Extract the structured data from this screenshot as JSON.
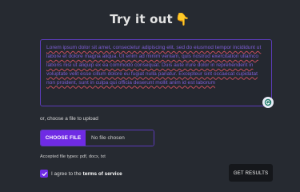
{
  "header": {
    "title": "Try it out",
    "emoji": "👇"
  },
  "text_input": {
    "value": "Lorem ipsum dolor sit amet, consectetur adipiscing elit, sed do eiusmod tempor incididunt ut labore et dolore magna aliqua. Ut enim ad minim veniam, quis nostrud exercitation ullamco laboris nisi ut aliquip ex ea commodo consequat. Duis aute irure dolor in reprehenderit in voluptate velit esse cillum dolore eu fugiat nulla pariatur. Excepteur sint occaecat cupidatat non proident, sunt in culpa qui officia deserunt mollit anim id est laborum",
    "grammar_icon": "grammarly-icon"
  },
  "file_upload": {
    "prompt": "or, choose a file to upload",
    "button_label": "CHOOSE FILE",
    "status": "No file chosen",
    "accepted_types": "Accepted file types: pdf, docx, txt"
  },
  "agreement": {
    "checked": true,
    "text": "I agree to the",
    "link": "terms of service"
  },
  "submit": {
    "label": "GET RESULTS"
  },
  "colors": {
    "background": "#262a31",
    "accent": "#6f2be4",
    "border": "#5b3bb8",
    "text_purple": "#7e5ed6",
    "button_dark": "#15171b"
  }
}
